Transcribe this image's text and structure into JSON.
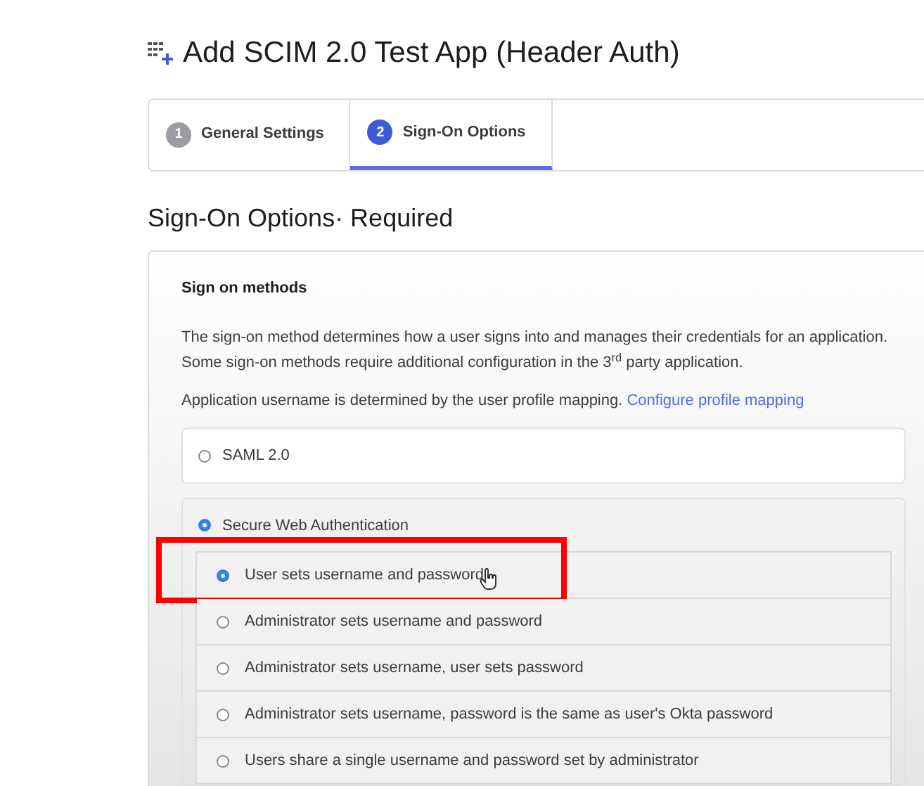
{
  "title": "Add SCIM 2.0 Test App (Header Auth)",
  "steps": [
    {
      "number": "1",
      "label": "General Settings",
      "selected": false
    },
    {
      "number": "2",
      "label": "Sign-On Options",
      "selected": true
    }
  ],
  "section_title": "Sign-On Options· Required",
  "sign_on": {
    "heading": "Sign on methods",
    "description": "The sign-on method determines how a user signs into and manages their credentials for an application. Some sign-on methods require additional configuration in the 3$^{rd}$ party application.",
    "mapping_text": "Application username is determined by the user profile mapping.",
    "mapping_link": "Configure profile mapping",
    "methods": [
      {
        "label": "SAML 2.0",
        "selected": false
      },
      {
        "label": "Secure Web Authentication",
        "selected": true,
        "options": [
          {
            "label": "User sets username and password",
            "selected": true,
            "highlighted": true
          },
          {
            "label": "Administrator sets username and password",
            "selected": false,
            "highlighted": false
          },
          {
            "label": "Administrator sets username, user sets password",
            "selected": false,
            "highlighted": false
          },
          {
            "label": "Administrator sets username, password is the same as user's Okta password",
            "selected": false,
            "highlighted": false
          },
          {
            "label": "Users share a single username and password set by administrator",
            "selected": false,
            "highlighted": false
          }
        ]
      }
    ]
  }
}
